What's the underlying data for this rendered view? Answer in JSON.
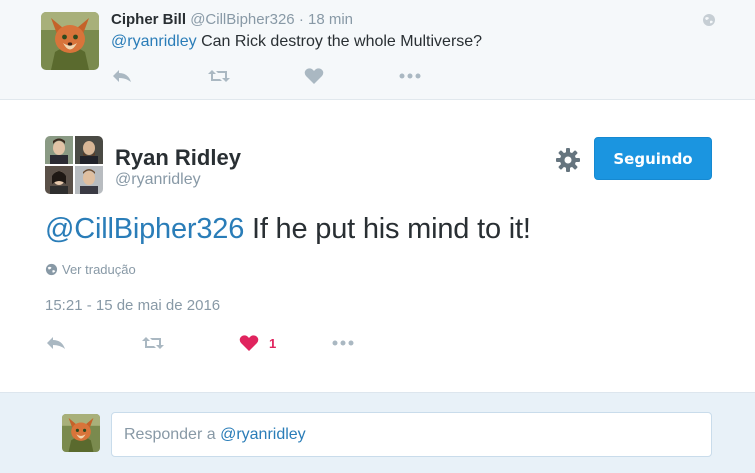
{
  "parent_tweet": {
    "author_name": "Cipher Bill",
    "author_handle": "@CillBipher326",
    "separator": "·",
    "time": "18 min",
    "mention": "@ryanridley",
    "text": "Can Rick destroy the whole Multiverse?",
    "icons": [
      "reply-icon",
      "retweet-icon",
      "like-icon",
      "more-icon",
      "globe-icon"
    ]
  },
  "main_tweet": {
    "author_name": "Ryan Ridley",
    "author_handle": "@ryanridley",
    "follow_label": "Seguindo",
    "mention": "@CillBipher326",
    "text": "If he put his mind to it!",
    "translate_label": "Ver tradução",
    "timestamp": "15:21 - 15 de mai de 2016",
    "like_count": "1",
    "icons": [
      "gear-icon",
      "reply-icon",
      "retweet-icon",
      "heart-icon",
      "more-icon",
      "globe-icon"
    ]
  },
  "reply_box": {
    "placeholder_prefix": "Responder a",
    "placeholder_mention": "@ryanridley"
  },
  "colors": {
    "link": "#2a7db8",
    "button": "#1b95e0",
    "like": "#e0245e",
    "muted": "#8899a6",
    "text": "#292f33"
  }
}
